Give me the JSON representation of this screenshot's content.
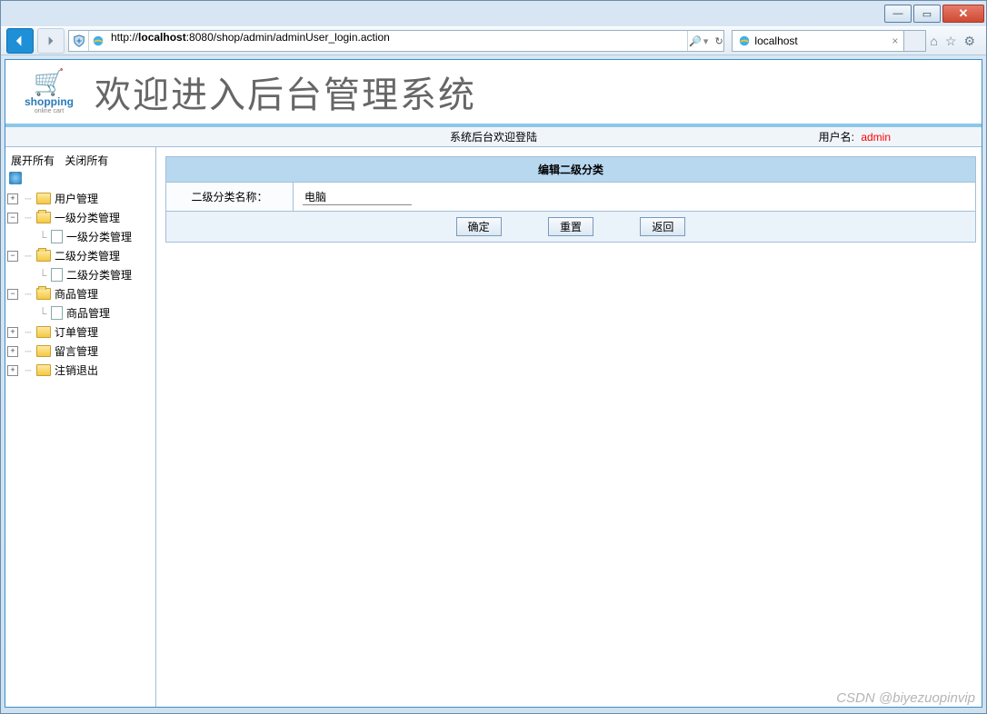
{
  "browser": {
    "url_prefix": "http://",
    "url_host": "localhost",
    "url_path": ":8080/shop/admin/adminUser_login.action",
    "tab_title": "localhost",
    "search_hint": "🔍"
  },
  "header": {
    "logo_text": "shopping",
    "logo_sub": "online cart",
    "main_title": "欢迎进入后台管理系统"
  },
  "topbar": {
    "welcome": "系统后台欢迎登陆",
    "user_label": "用户名:",
    "username": "admin"
  },
  "sidebar": {
    "expand_all": "展开所有",
    "collapse_all": "关闭所有",
    "items": [
      {
        "label": "用户管理",
        "expanded": false
      },
      {
        "label": "一级分类管理",
        "expanded": true,
        "child": "一级分类管理"
      },
      {
        "label": "二级分类管理",
        "expanded": true,
        "child": "二级分类管理"
      },
      {
        "label": "商品管理",
        "expanded": true,
        "child": "商品管理"
      },
      {
        "label": "订单管理",
        "expanded": false
      },
      {
        "label": "留言管理",
        "expanded": false
      },
      {
        "label": "注销退出",
        "expanded": false
      }
    ]
  },
  "form": {
    "panel_title": "编辑二级分类",
    "field_label": "二级分类名称：",
    "field_value": "电脑",
    "btn_ok": "确定",
    "btn_reset": "重置",
    "btn_back": "返回"
  },
  "watermark": "CSDN @biyezuopinvip"
}
